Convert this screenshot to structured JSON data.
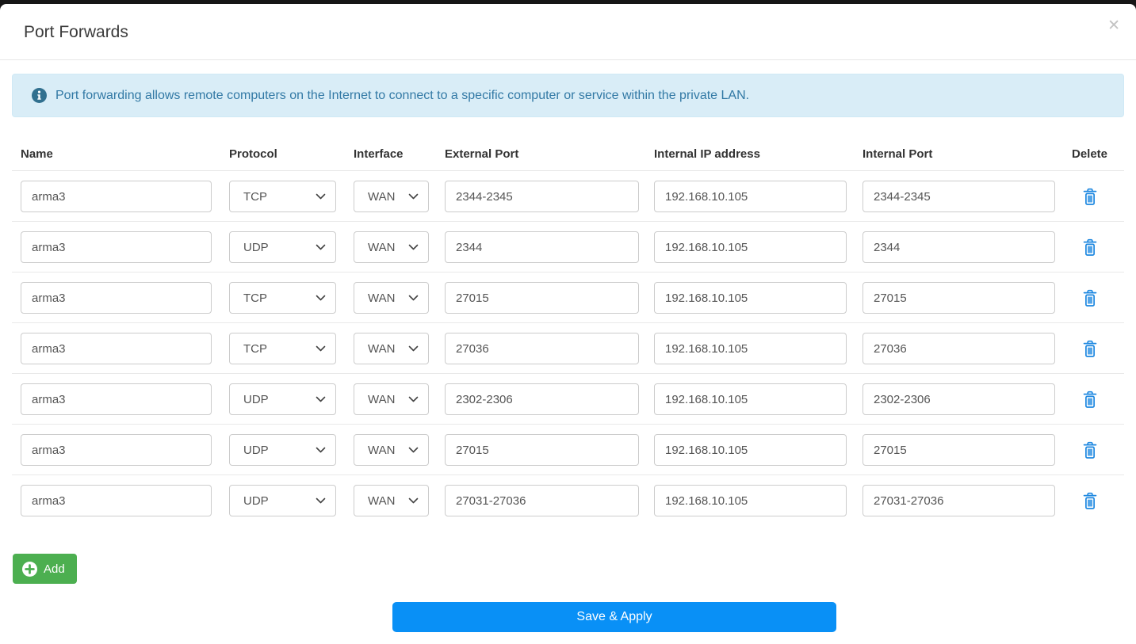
{
  "modal": {
    "title": "Port Forwards",
    "close_glyph": "✕"
  },
  "banner": {
    "icon": "info-icon",
    "text": "Port forwarding allows remote computers on the Internet to connect to a specific computer or service within the private LAN."
  },
  "table": {
    "headers": [
      "Name",
      "Protocol",
      "Interface",
      "External Port",
      "Internal IP address",
      "Internal Port",
      "Delete"
    ],
    "rows": [
      {
        "name": "arma3",
        "protocol": "TCP",
        "interface": "WAN",
        "external_port": "2344-2345",
        "internal_ip": "192.168.10.105",
        "internal_port": "2344-2345"
      },
      {
        "name": "arma3",
        "protocol": "UDP",
        "interface": "WAN",
        "external_port": "2344",
        "internal_ip": "192.168.10.105",
        "internal_port": "2344"
      },
      {
        "name": "arma3",
        "protocol": "TCP",
        "interface": "WAN",
        "external_port": "27015",
        "internal_ip": "192.168.10.105",
        "internal_port": "27015"
      },
      {
        "name": "arma3",
        "protocol": "TCP",
        "interface": "WAN",
        "external_port": "27036",
        "internal_ip": "192.168.10.105",
        "internal_port": "27036"
      },
      {
        "name": "arma3",
        "protocol": "UDP",
        "interface": "WAN",
        "external_port": "2302-2306",
        "internal_ip": "192.168.10.105",
        "internal_port": "2302-2306"
      },
      {
        "name": "arma3",
        "protocol": "UDP",
        "interface": "WAN",
        "external_port": "27015",
        "internal_ip": "192.168.10.105",
        "internal_port": "27015"
      },
      {
        "name": "arma3",
        "protocol": "UDP",
        "interface": "WAN",
        "external_port": "27031-27036",
        "internal_ip": "192.168.10.105",
        "internal_port": "27031-27036"
      }
    ]
  },
  "buttons": {
    "add_label": "Add",
    "save_label": "Save & Apply"
  },
  "icons": {
    "info": "info-circle",
    "add": "plus-circle",
    "delete": "trash",
    "select": "chevron-down",
    "close": "x"
  },
  "colors": {
    "save_blue": "#0990f6",
    "trash_blue": "#1c87e0",
    "add_green": "#4caf50",
    "banner_bg": "#d9edf7",
    "banner_text": "#3279a5"
  }
}
